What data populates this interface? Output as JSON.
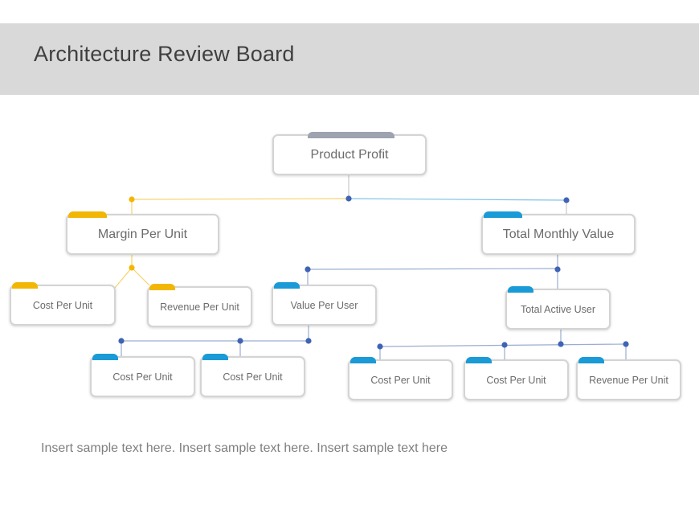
{
  "slide": {
    "title": "Architecture Review Board",
    "footer_text": "Insert sample text here. Insert sample text here. Insert sample text here"
  },
  "colors": {
    "header_bg": "#d9d9d9",
    "yellow_accent": "#f2b705",
    "blue_accent": "#1a9ad6",
    "gray_accent": "#9ea3b0",
    "node_dot": "#3f63b5",
    "blue_line": "#7aa7d8",
    "yellow_line": "#f5d36b"
  },
  "diagram": {
    "root": {
      "label": "Product Profit",
      "accent": "gray"
    },
    "level1": [
      {
        "label": "Margin Per Unit",
        "accent": "yellow"
      },
      {
        "label": "Total Monthly Value",
        "accent": "blue"
      }
    ],
    "margin_children": [
      {
        "label": "Cost Per Unit",
        "accent": "yellow"
      },
      {
        "label": "Revenue Per Unit",
        "accent": "yellow"
      }
    ],
    "value_children": [
      {
        "label": "Value Per User",
        "accent": "blue"
      },
      {
        "label": "Total Active User",
        "accent": "blue"
      }
    ],
    "value_per_user_children": [
      {
        "label": "Cost Per Unit",
        "accent": "blue"
      },
      {
        "label": "Cost Per Unit",
        "accent": "blue"
      }
    ],
    "active_user_children": [
      {
        "label": "Cost Per Unit",
        "accent": "blue"
      },
      {
        "label": "Cost Per Unit",
        "accent": "blue"
      },
      {
        "label": "Revenue Per Unit",
        "accent": "blue"
      }
    ]
  }
}
